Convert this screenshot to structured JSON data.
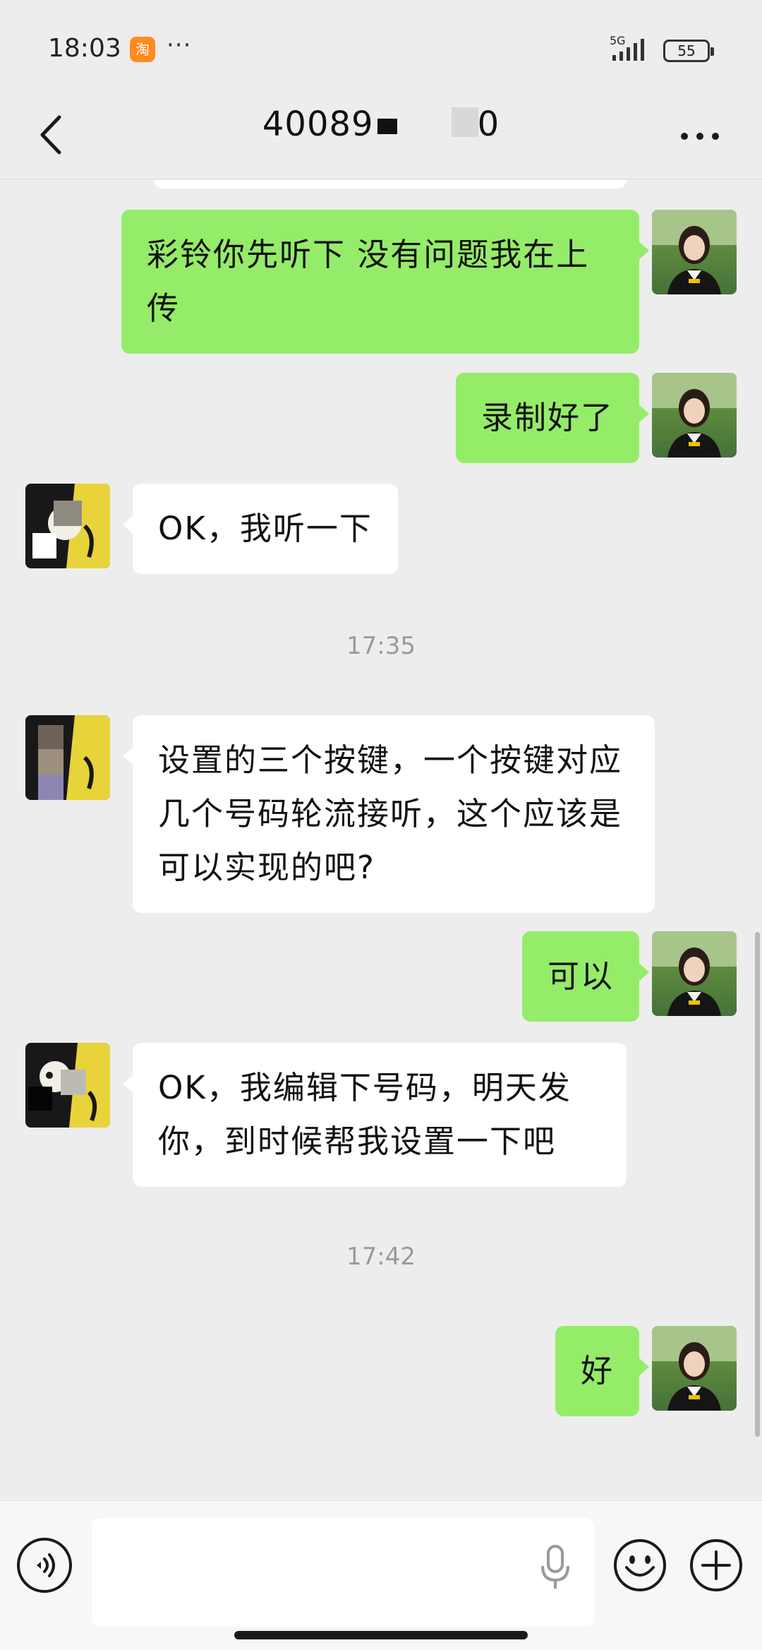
{
  "status_bar": {
    "time": "18:03",
    "app_icon": "taobao-icon",
    "more": "···",
    "network": "5G",
    "battery": "55"
  },
  "nav": {
    "back_icon": "chevron-left-icon",
    "title": "40089   0",
    "more_icon": "more-icon"
  },
  "messages": [
    {
      "side": "sent",
      "text": "彩铃你先听下  没有问题我在上传"
    },
    {
      "side": "sent",
      "text": "录制好了"
    },
    {
      "side": "recv",
      "text": "OK，我听一下"
    },
    {
      "side": "time",
      "text": "17:35"
    },
    {
      "side": "recv",
      "text": "设置的三个按键，一个按键对应几个号码轮流接听，这个应该是可以实现的吧?"
    },
    {
      "side": "sent",
      "text": "可以"
    },
    {
      "side": "recv",
      "text": "OK，我编辑下号码，明天发你，到时候帮我设置一下吧"
    },
    {
      "side": "time",
      "text": "17:42"
    },
    {
      "side": "sent",
      "text": "好"
    }
  ],
  "input_bar": {
    "voice_icon": "voice-toggle-icon",
    "placeholder": "",
    "mic_icon": "microphone-icon",
    "emoji_icon": "emoji-icon",
    "plus_icon": "plus-icon"
  },
  "colors": {
    "background": "#ededed",
    "sent_bubble": "#95ec69",
    "recv_bubble": "#ffffff",
    "timestamp": "#9a9a9a"
  }
}
